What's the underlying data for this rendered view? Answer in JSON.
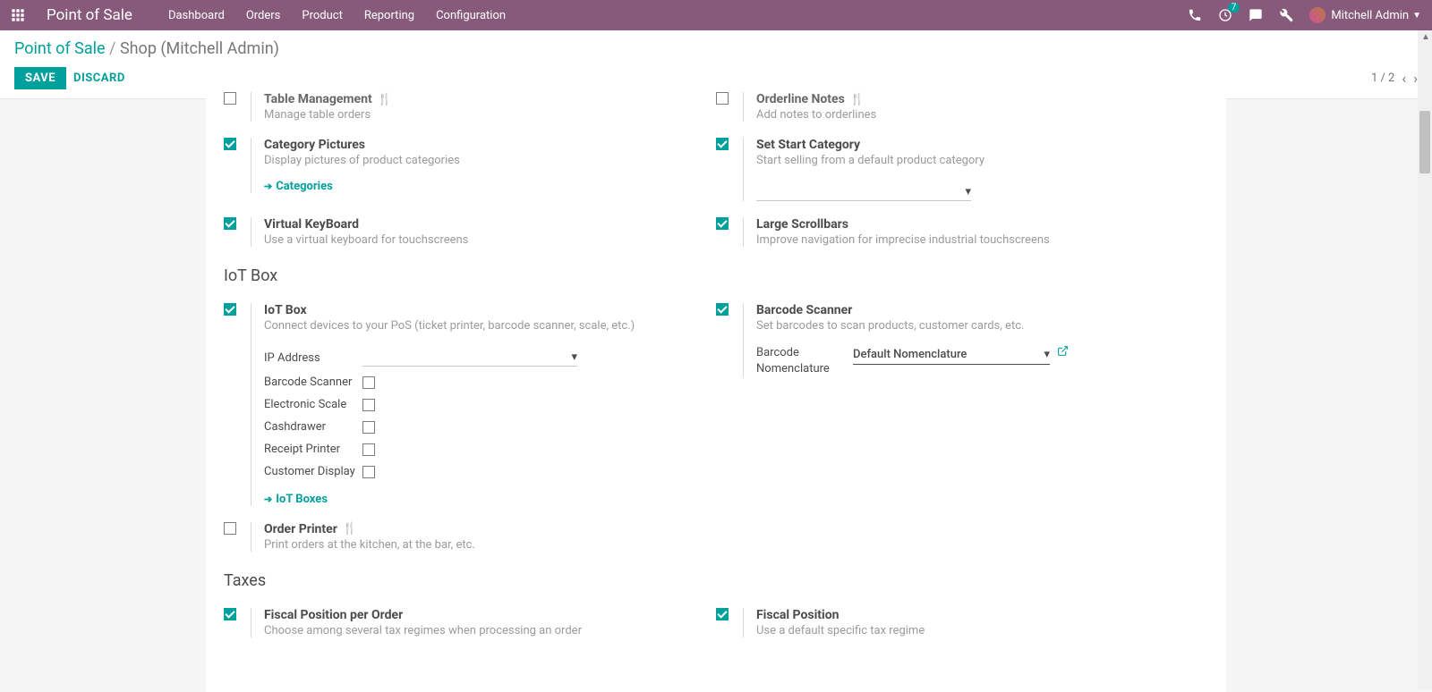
{
  "header": {
    "brand": "Point of Sale",
    "menu": [
      "Dashboard",
      "Orders",
      "Product",
      "Reporting",
      "Configuration"
    ],
    "badge": "7",
    "user": "Mitchell Admin"
  },
  "breadcrumb": {
    "root": "Point of Sale",
    "current": "Shop (Mitchell Admin)"
  },
  "actions": {
    "save": "SAVE",
    "discard": "DISCARD",
    "pager": "1 / 2"
  },
  "partial_top": {
    "left": {
      "title": "Table Management",
      "desc": "Manage table orders"
    },
    "right": {
      "title": "Orderline Notes",
      "desc": "Add notes to orderlines"
    }
  },
  "block1": {
    "left": {
      "title": "Category Pictures",
      "desc": "Display pictures of product categories",
      "link": "Categories"
    },
    "right": {
      "title": "Set Start Category",
      "desc": "Start selling from a default product category"
    }
  },
  "block2": {
    "left": {
      "title": "Virtual KeyBoard",
      "desc": "Use a virtual keyboard for touchscreens"
    },
    "right": {
      "title": "Large Scrollbars",
      "desc": "Improve navigation for imprecise industrial touchscreens"
    }
  },
  "section_iot": "IoT Box",
  "iot": {
    "left": {
      "title": "IoT Box",
      "desc": "Connect devices to your PoS (ticket printer, barcode scanner, scale, etc.)",
      "ip_label": "IP Address",
      "opts": [
        "Barcode Scanner",
        "Electronic Scale",
        "Cashdrawer",
        "Receipt Printer",
        "Customer Display"
      ],
      "link": "IoT Boxes"
    },
    "right": {
      "title": "Barcode Scanner",
      "desc": "Set barcodes to scan products, customer cards, etc.",
      "field_label": "Barcode Nomenclature",
      "field_value": "Default Nomenclature"
    }
  },
  "order_printer": {
    "title": "Order Printer",
    "desc": "Print orders at the kitchen, at the bar, etc."
  },
  "section_taxes": "Taxes",
  "taxes": {
    "left": {
      "title": "Fiscal Position per Order",
      "desc": "Choose among several tax regimes when processing an order"
    },
    "right": {
      "title": "Fiscal Position",
      "desc": "Use a default specific tax regime"
    }
  }
}
